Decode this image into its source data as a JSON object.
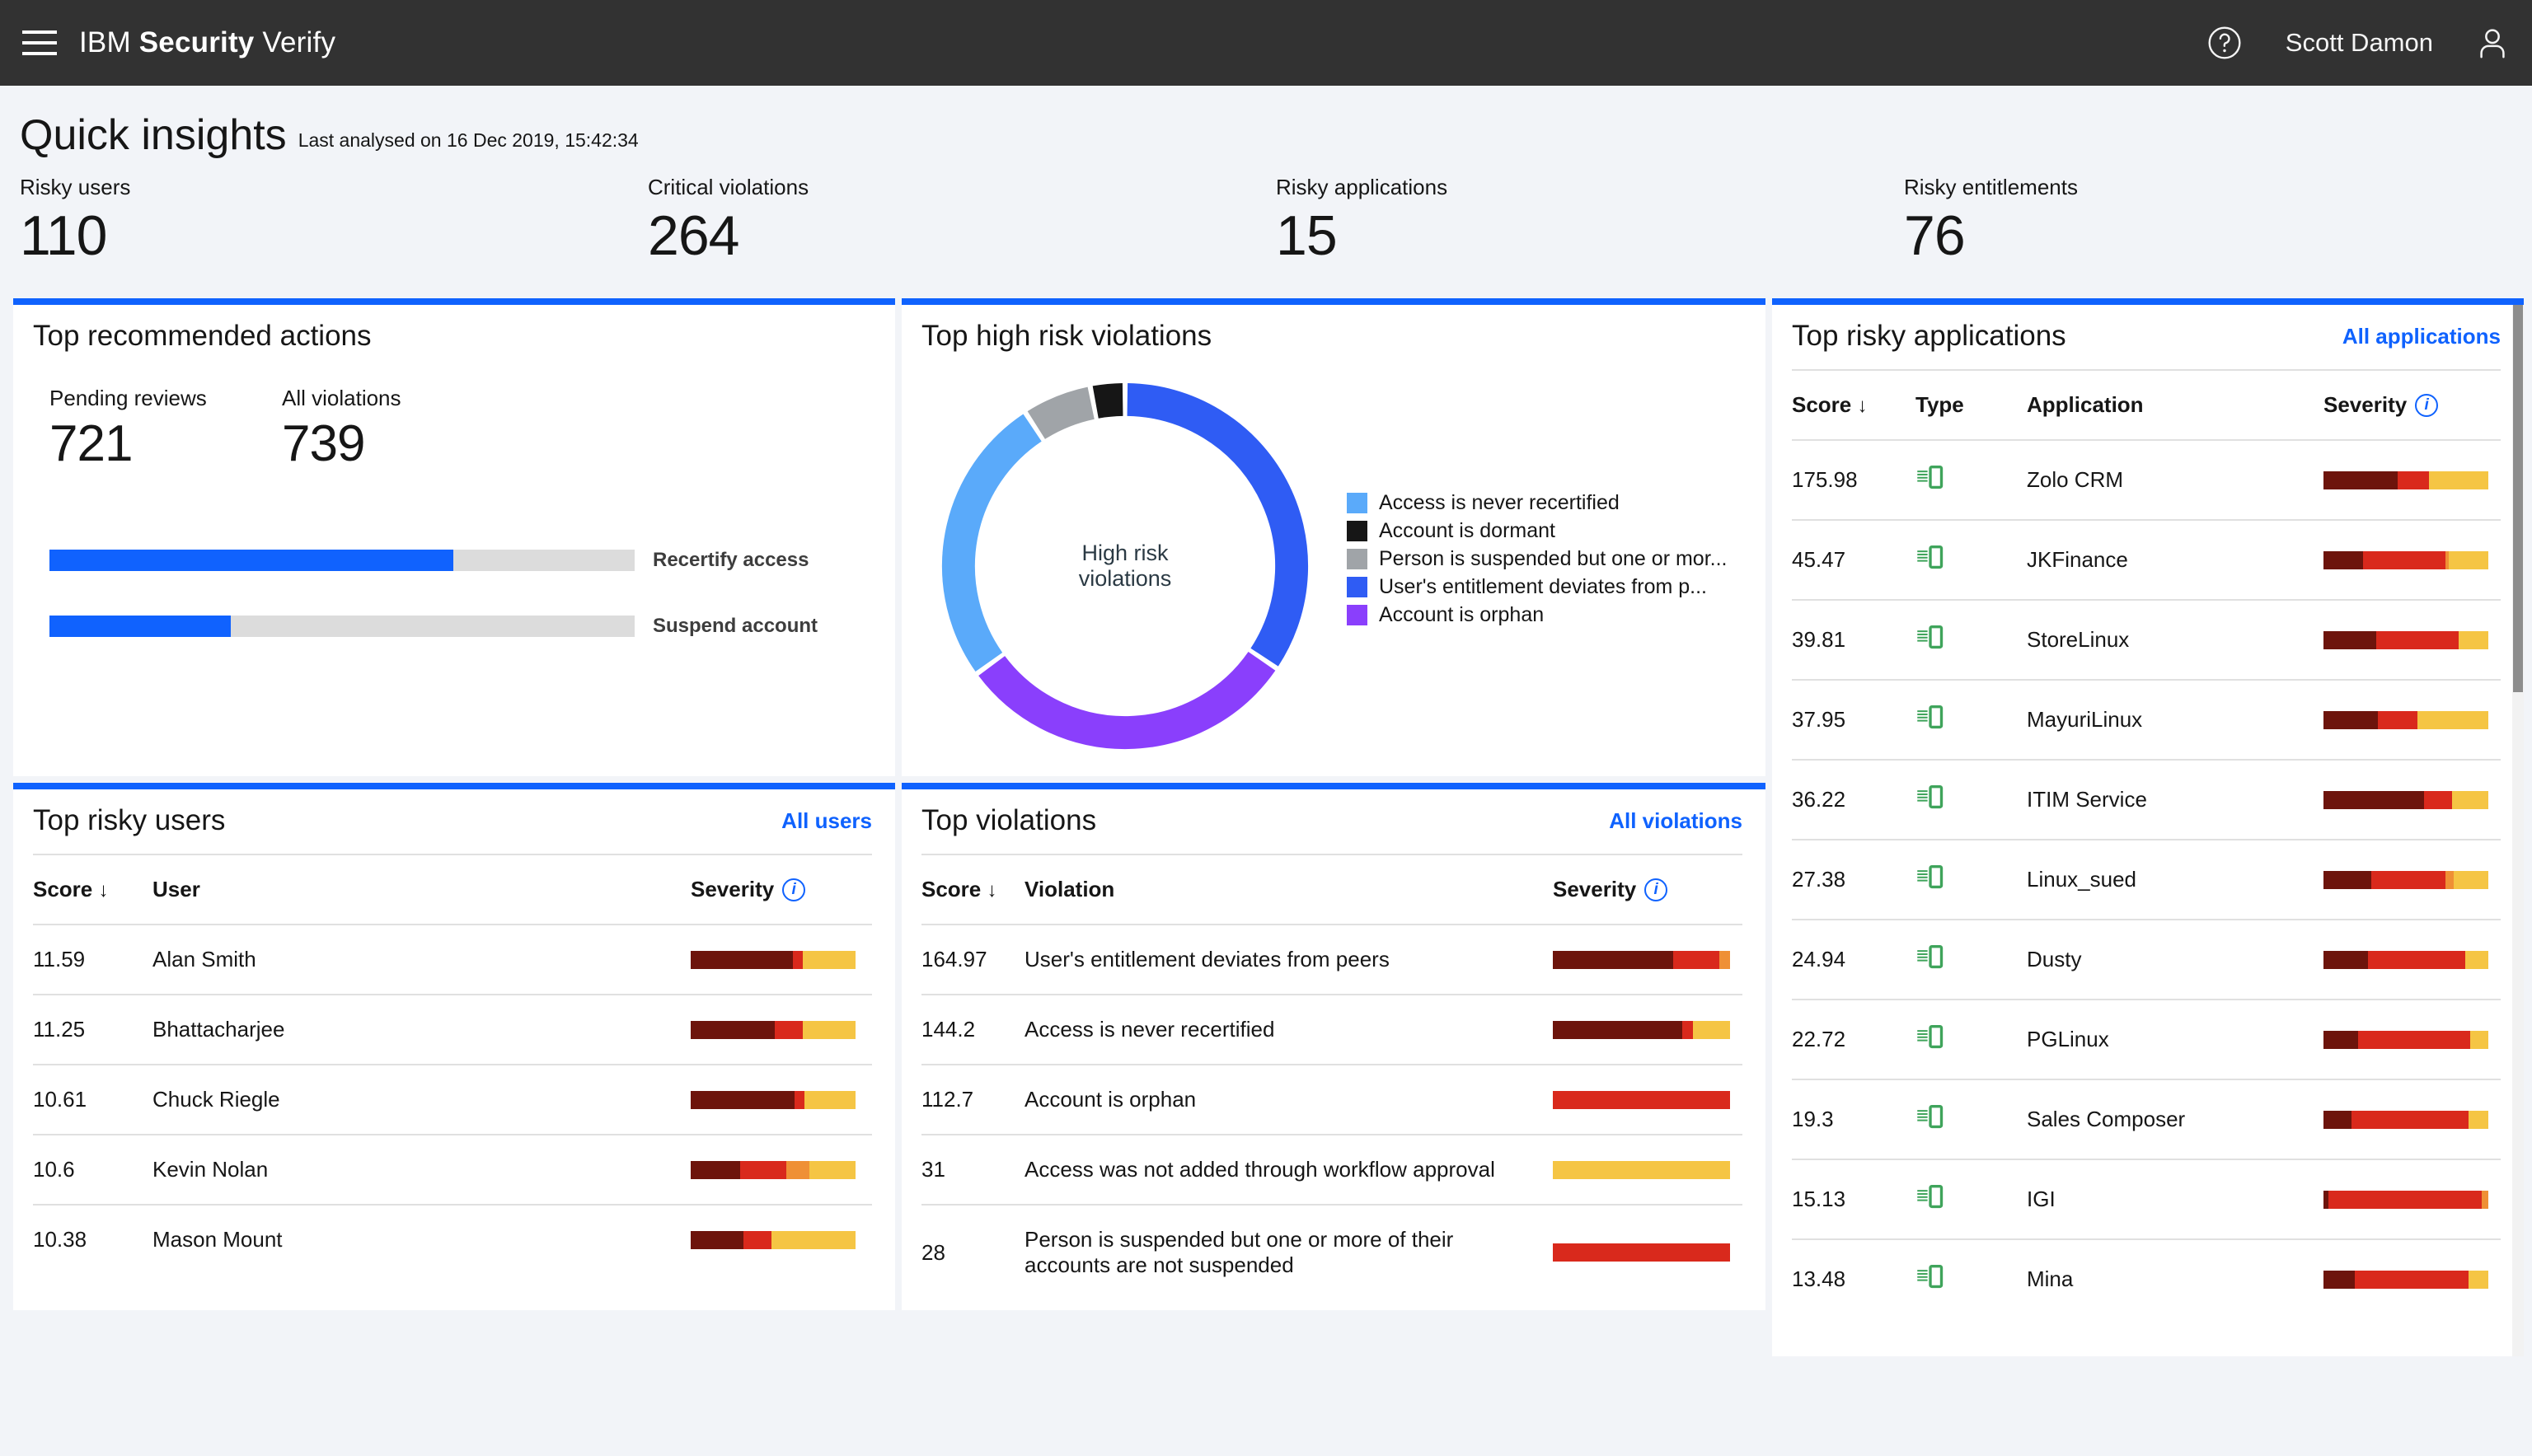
{
  "topbar": {
    "menu_icon": "hamburger-menu-icon",
    "brand_prefix": "IBM ",
    "brand_bold": "Security",
    "brand_suffix": " Verify",
    "help_icon": "help-circle-icon",
    "user_name": "Scott Damon",
    "avatar_icon": "user-avatar-icon"
  },
  "page": {
    "title": "Quick insights",
    "subtitle": "Last analysed on 16 Dec 2019, 15:42:34"
  },
  "kpis": [
    {
      "label": "Risky users",
      "value": "110"
    },
    {
      "label": "Critical violations",
      "value": "264"
    },
    {
      "label": "Risky applications",
      "value": "15"
    },
    {
      "label": "Risky entitlements",
      "value": "76"
    }
  ],
  "recommended": {
    "title": "Top recommended actions",
    "stats": [
      {
        "label": "Pending reviews",
        "value": "721"
      },
      {
        "label": "All violations",
        "value": "739"
      }
    ],
    "bars": [
      {
        "label": "Recertify access",
        "pct": 69
      },
      {
        "label": "Suspend account",
        "pct": 31
      }
    ]
  },
  "high_risk": {
    "title": "Top high risk violations",
    "center_line1": "High risk",
    "center_line2": "violations"
  },
  "chart_data": {
    "type": "pie",
    "title": "Top high risk violations",
    "center_label": "High risk violations",
    "legend_position": "right",
    "donut": true,
    "categories": [
      "User's entitlement deviates from p...",
      "Account is orphan",
      "Access is never recertified",
      "Person is suspended but one or mor...",
      "Account is dormant"
    ],
    "legend": [
      {
        "label": "Access is never recertified",
        "color": "#5aaafa"
      },
      {
        "label": "Account is dormant",
        "color": "#161616"
      },
      {
        "label": "Person is suspended but one or mor...",
        "color": "#a0a4a8"
      },
      {
        "label": "User's entitlement deviates from p...",
        "color": "#2f5cf4"
      },
      {
        "label": "Account is orphan",
        "color": "#8a3ffc"
      }
    ],
    "segments": [
      {
        "label": "User's entitlement deviates from p...",
        "color": "#2f5cf4",
        "degrees": 124,
        "value": 34.4
      },
      {
        "label": "Account is orphan",
        "color": "#8a3ffc",
        "degrees": 110,
        "value": 30.6
      },
      {
        "label": "Access is never recertified",
        "color": "#5aaafa",
        "degrees": 93,
        "value": 25.8
      },
      {
        "label": "Person is suspended but one or mor...",
        "color": "#a0a4a8",
        "degrees": 22,
        "value": 6.1
      },
      {
        "label": "Account is dormant",
        "color": "#161616",
        "degrees": 11,
        "value": 3.1
      }
    ],
    "values": [
      34.4,
      30.6,
      25.8,
      6.1,
      3.1
    ]
  },
  "risky_users": {
    "title": "Top risky users",
    "link": "All users",
    "columns": [
      "Score",
      "User",
      "Severity"
    ],
    "sort_icon": "sort-descending-arrow",
    "info_icon": "info-icon",
    "rows": [
      {
        "score": "11.59",
        "user": "Alan Smith",
        "severity": [
          [
            62,
            "#6d140c"
          ],
          [
            6,
            "#d9291c"
          ],
          [
            32,
            "#f5c544"
          ]
        ]
      },
      {
        "score": "11.25",
        "user": "Bhattacharjee",
        "severity": [
          [
            51,
            "#6d140c"
          ],
          [
            17,
            "#d9291c"
          ],
          [
            32,
            "#f5c544"
          ]
        ]
      },
      {
        "score": "10.61",
        "user": "Chuck Riegle",
        "severity": [
          [
            63,
            "#6d140c"
          ],
          [
            6,
            "#d9291c"
          ],
          [
            31,
            "#f5c544"
          ]
        ]
      },
      {
        "score": "10.6",
        "user": "Kevin Nolan",
        "severity": [
          [
            30,
            "#6d140c"
          ],
          [
            28,
            "#d9291c"
          ],
          [
            14,
            "#ef9035"
          ],
          [
            28,
            "#f5c544"
          ]
        ]
      },
      {
        "score": "10.38",
        "user": "Mason Mount",
        "severity": [
          [
            32,
            "#6d140c"
          ],
          [
            17,
            "#d9291c"
          ],
          [
            51,
            "#f5c544"
          ]
        ]
      }
    ]
  },
  "violations": {
    "title": "Top violations",
    "link": "All violations",
    "columns": [
      "Score",
      "Violation",
      "Severity"
    ],
    "sort_icon": "sort-descending-arrow",
    "info_icon": "info-icon",
    "rows": [
      {
        "score": "164.97",
        "violation": "User's entitlement deviates from peers",
        "severity": [
          [
            68,
            "#6d140c"
          ],
          [
            26,
            "#d9291c"
          ],
          [
            6,
            "#ef9035"
          ]
        ]
      },
      {
        "score": "144.2",
        "violation": "Access is never recertified",
        "severity": [
          [
            73,
            "#6d140c"
          ],
          [
            6,
            "#d9291c"
          ],
          [
            21,
            "#f5c544"
          ]
        ]
      },
      {
        "score": "112.7",
        "violation": "Account is orphan",
        "severity": [
          [
            100,
            "#d9291c"
          ]
        ]
      },
      {
        "score": "31",
        "violation": "Access was not added through workflow approval",
        "severity": [
          [
            100,
            "#f5c544"
          ]
        ]
      },
      {
        "score": "28",
        "violation": "Person is suspended but one or more of their accounts are not suspended",
        "severity": [
          [
            100,
            "#d9291c"
          ]
        ]
      }
    ]
  },
  "risky_apps": {
    "title": "Top risky applications",
    "link": "All applications",
    "columns": [
      "Score",
      "Type",
      "Application",
      "Severity"
    ],
    "sort_icon": "sort-descending-arrow",
    "info_icon": "info-icon",
    "type_icon": "application-icon",
    "rows": [
      {
        "score": "175.98",
        "application": "Zolo CRM",
        "severity": [
          [
            45,
            "#6d140c"
          ],
          [
            19,
            "#d9291c"
          ],
          [
            36,
            "#f5c544"
          ]
        ]
      },
      {
        "score": "45.47",
        "application": "JKFinance",
        "severity": [
          [
            24,
            "#6d140c"
          ],
          [
            50,
            "#d9291c"
          ],
          [
            2,
            "#ef9035"
          ],
          [
            24,
            "#f5c544"
          ]
        ]
      },
      {
        "score": "39.81",
        "application": "StoreLinux",
        "severity": [
          [
            32,
            "#6d140c"
          ],
          [
            50,
            "#d9291c"
          ],
          [
            18,
            "#f5c544"
          ]
        ]
      },
      {
        "score": "37.95",
        "application": "MayuriLinux",
        "severity": [
          [
            33,
            "#6d140c"
          ],
          [
            24,
            "#d9291c"
          ],
          [
            43,
            "#f5c544"
          ]
        ]
      },
      {
        "score": "36.22",
        "application": "ITIM Service",
        "severity": [
          [
            61,
            "#6d140c"
          ],
          [
            17,
            "#d9291c"
          ],
          [
            22,
            "#f5c544"
          ]
        ]
      },
      {
        "score": "27.38",
        "application": "Linux_sued",
        "severity": [
          [
            29,
            "#6d140c"
          ],
          [
            45,
            "#d9291c"
          ],
          [
            5,
            "#ef9035"
          ],
          [
            21,
            "#f5c544"
          ]
        ]
      },
      {
        "score": "24.94",
        "application": "Dusty",
        "severity": [
          [
            27,
            "#6d140c"
          ],
          [
            59,
            "#d9291c"
          ],
          [
            14,
            "#f5c544"
          ]
        ]
      },
      {
        "score": "22.72",
        "application": "PGLinux",
        "severity": [
          [
            21,
            "#6d140c"
          ],
          [
            68,
            "#d9291c"
          ],
          [
            11,
            "#f5c544"
          ]
        ]
      },
      {
        "score": "19.3",
        "application": "Sales Composer",
        "severity": [
          [
            17,
            "#6d140c"
          ],
          [
            71,
            "#d9291c"
          ],
          [
            12,
            "#f5c544"
          ]
        ]
      },
      {
        "score": "15.13",
        "application": "IGI",
        "severity": [
          [
            3,
            "#6d140c"
          ],
          [
            93,
            "#d9291c"
          ],
          [
            4,
            "#ef9035"
          ]
        ]
      },
      {
        "score": "13.48",
        "application": "Mina",
        "severity": [
          [
            19,
            "#6d140c"
          ],
          [
            69,
            "#d9291c"
          ],
          [
            12,
            "#f5c544"
          ]
        ]
      }
    ]
  },
  "colors": {
    "accent": "#0f62fe",
    "topbar_bg": "#323232",
    "page_bg": "#f2f4f8",
    "severity_critical": "#6d140c",
    "severity_high": "#d9291c",
    "severity_medium": "#ef9035",
    "severity_low": "#f5c544"
  }
}
